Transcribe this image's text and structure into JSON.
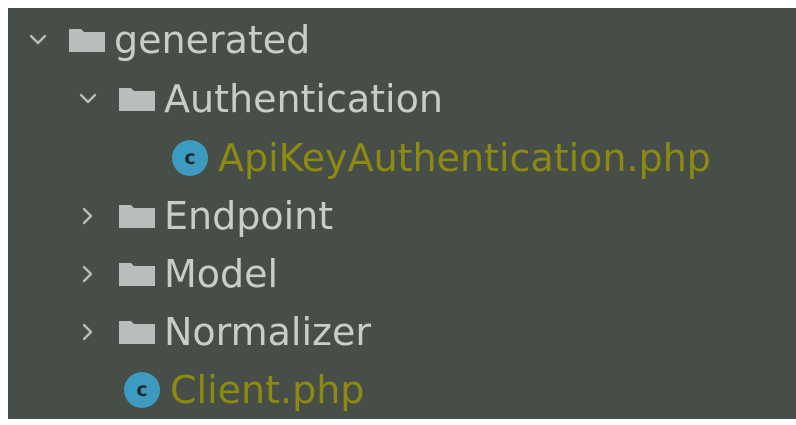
{
  "tree": {
    "root": {
      "label": "generated",
      "state": "expanded",
      "icon": "folder-icon"
    },
    "authentication": {
      "label": "Authentication",
      "state": "expanded",
      "icon": "folder-icon"
    },
    "api_key_file": {
      "label": "ApiKeyAuthentication.php",
      "icon": "php-class-icon",
      "icon_letter": "c"
    },
    "endpoint": {
      "label": "Endpoint",
      "state": "collapsed",
      "icon": "folder-icon"
    },
    "model": {
      "label": "Model",
      "state": "collapsed",
      "icon": "folder-icon"
    },
    "normalizer": {
      "label": "Normalizer",
      "state": "collapsed",
      "icon": "folder-icon"
    },
    "client_file": {
      "label": "Client.php",
      "icon": "php-class-icon",
      "icon_letter": "c"
    }
  },
  "colors": {
    "background": "#464e47",
    "folder_text": "#c9cdc9",
    "file_text": "#8d8a12",
    "class_icon": "#3d9ac0"
  }
}
